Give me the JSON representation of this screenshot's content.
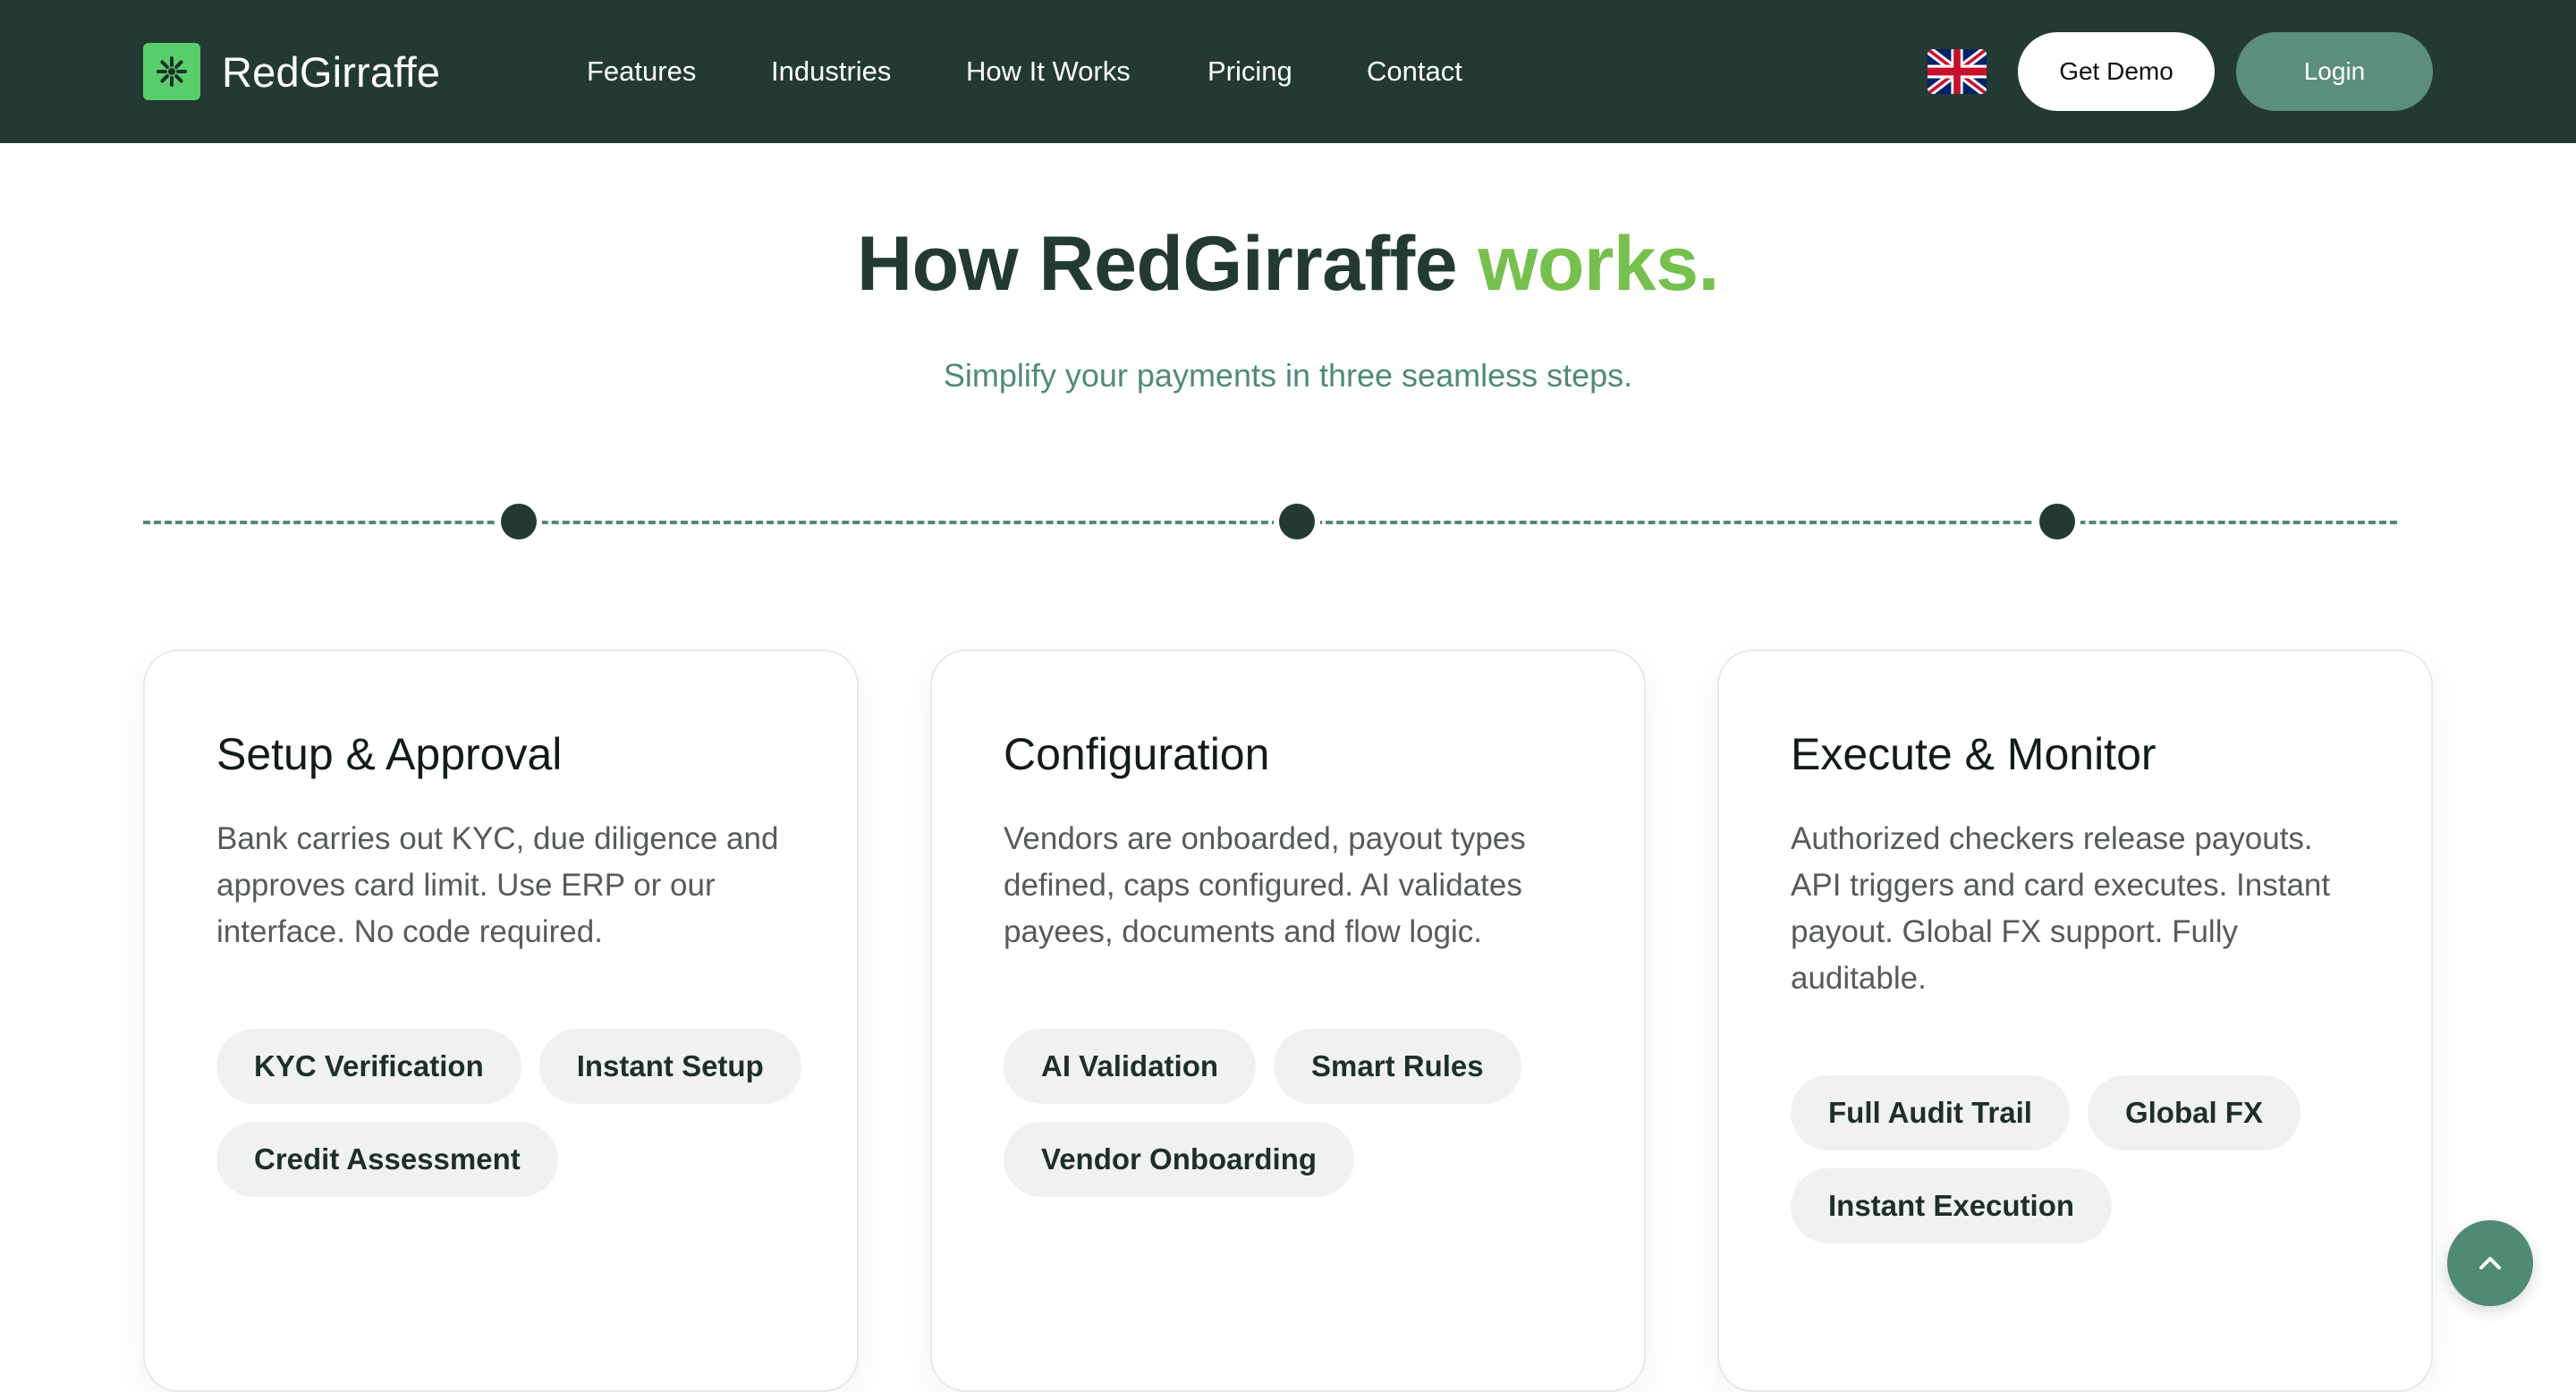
{
  "header": {
    "brand": "RedGirraffe",
    "nav": [
      "Features",
      "Industries",
      "How It Works",
      "Pricing",
      "Contact"
    ],
    "language_icon": "uk-flag-icon",
    "get_demo_label": "Get Demo",
    "login_label": "Login"
  },
  "hero": {
    "title_main": "How RedGirraffe",
    "title_accent": "works.",
    "subtitle": "Simplify your payments in three seamless steps."
  },
  "steps": [
    {
      "title": "Setup & Approval",
      "description": "Bank carries out KYC, due diligence and approves card limit. Use ERP or our interface. No code required.",
      "tags": [
        "KYC Verification",
        "Instant Setup",
        "Credit Assessment"
      ]
    },
    {
      "title": "Configuration",
      "description": "Vendors are onboarded, payout types defined, caps configured. AI validates payees, documents and flow logic.",
      "tags": [
        "AI Validation",
        "Smart Rules",
        "Vendor Onboarding"
      ]
    },
    {
      "title": "Execute & Monitor",
      "description": "Authorized checkers release payouts. API triggers and card executes. Instant payout. Global FX support. Fully auditable.",
      "tags": [
        "Full Audit Trail",
        "Global FX",
        "Instant Execution"
      ]
    }
  ],
  "colors": {
    "header_bg": "#223a33",
    "accent_green": "#76c04e",
    "subtitle_green": "#4f8b72",
    "login_button": "#5b8e7b",
    "logo_green": "#58cf6a"
  },
  "scroll_top_icon": "chevron-up-icon"
}
